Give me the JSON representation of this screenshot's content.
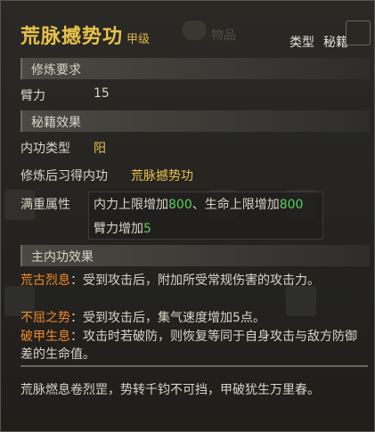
{
  "header": {
    "title": "荒脉撼势功",
    "grade": "甲级",
    "type_label": "类型",
    "type_value": "秘籍",
    "background_tab": "物品"
  },
  "requirements": {
    "section_title": "修炼要求",
    "stat_label": "臂力",
    "stat_value": "15"
  },
  "effects": {
    "section_title": "秘籍效果",
    "neigong_type_label": "内功类型",
    "neigong_type_value": "阳",
    "learn_label": "修炼后习得内功",
    "learn_value": "荒脉撼势功",
    "full_label": "满重属性",
    "line1_a": "内力上限增加",
    "line1_a_val": "800",
    "line1_sep": "、",
    "line1_b": "生命上限增加",
    "line1_b_val": "800",
    "line2_a": "臂力增加",
    "line2_a_val": "5"
  },
  "main": {
    "section_title": "主内功效果",
    "effects": [
      {
        "name": "荒古烈息",
        "desc": "：受到攻击后，附加所受常规伤害的攻击力。"
      },
      {
        "name": "不屈之势",
        "desc": "：受到攻击后，集气速度增加5点。"
      },
      {
        "name": "破甲生息",
        "desc": "：攻击时若破防，则恢复等同于自身攻击与敌方防御差的生命值。"
      }
    ]
  },
  "lore": "荒脉燃息卷烈罡，势转千钧不可挡，甲破犹生万里春。",
  "colors": {
    "title": "#e8c24a",
    "green": "#58d25a",
    "orange": "#f08a28"
  }
}
